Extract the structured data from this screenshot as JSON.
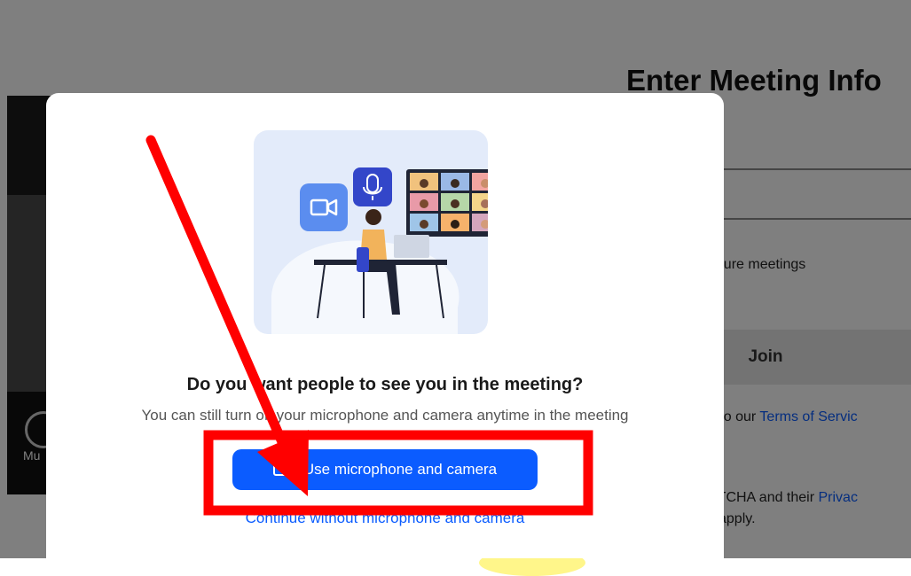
{
  "background_page": {
    "title": "Enter Meeting Info",
    "remember_text": "future meetings",
    "join_button": "Join",
    "terms_prefix": "e to our ",
    "terms_link": "Terms of Servic",
    "captcha_text": "PTCHA and their ",
    "privacy_link": "Privac",
    "apply_text": "apply.",
    "preview_label": "Mu"
  },
  "modal": {
    "heading": "Do you want people to see you in the meeting?",
    "subtext": "You can still turn off your microphone and camera anytime in the meeting",
    "primary_button": "Use microphone and camera",
    "secondary_link": "Continue without microphone and camera",
    "icons": [
      "video-camera-icon",
      "microphone-icon"
    ]
  },
  "colors": {
    "accent": "#0b5cff",
    "annotation_red": "#ff0000",
    "illustration_bg": "#e3ebfa"
  }
}
